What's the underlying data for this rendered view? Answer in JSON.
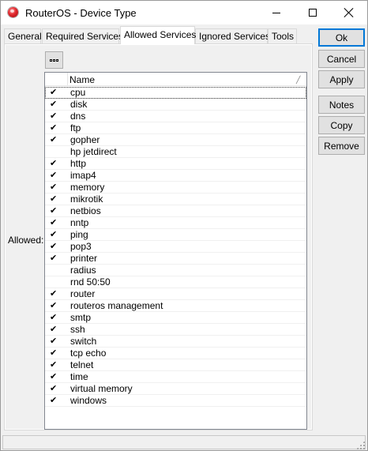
{
  "window": {
    "title": "RouterOS - Device Type"
  },
  "tabs": [
    {
      "label": "General"
    },
    {
      "label": "Required Services"
    },
    {
      "label": "Allowed Services",
      "active": true
    },
    {
      "label": "Ignored Services"
    },
    {
      "label": "Tools"
    }
  ],
  "form": {
    "allowed_label": "Allowed:",
    "column_name": "Name"
  },
  "services": [
    {
      "name": "cpu",
      "checked": true
    },
    {
      "name": "disk",
      "checked": true
    },
    {
      "name": "dns",
      "checked": true
    },
    {
      "name": "ftp",
      "checked": true
    },
    {
      "name": "gopher",
      "checked": true
    },
    {
      "name": "hp jetdirect",
      "checked": false
    },
    {
      "name": "http",
      "checked": true
    },
    {
      "name": "imap4",
      "checked": true
    },
    {
      "name": "memory",
      "checked": true
    },
    {
      "name": "mikrotik",
      "checked": true
    },
    {
      "name": "netbios",
      "checked": true
    },
    {
      "name": "nntp",
      "checked": true
    },
    {
      "name": "ping",
      "checked": true
    },
    {
      "name": "pop3",
      "checked": true
    },
    {
      "name": "printer",
      "checked": true
    },
    {
      "name": "radius",
      "checked": false
    },
    {
      "name": "rnd 50:50",
      "checked": false
    },
    {
      "name": "router",
      "checked": true
    },
    {
      "name": "routeros management",
      "checked": true
    },
    {
      "name": "smtp",
      "checked": true
    },
    {
      "name": "ssh",
      "checked": true
    },
    {
      "name": "switch",
      "checked": true
    },
    {
      "name": "tcp echo",
      "checked": true
    },
    {
      "name": "telnet",
      "checked": true
    },
    {
      "name": "time",
      "checked": true
    },
    {
      "name": "virtual memory",
      "checked": true
    },
    {
      "name": "windows",
      "checked": true
    }
  ],
  "buttons": {
    "ok": "Ok",
    "cancel": "Cancel",
    "apply": "Apply",
    "notes": "Notes",
    "copy": "Copy",
    "remove": "Remove"
  },
  "icons": {
    "app": "routeros-app-icon",
    "more": "ellipsis-icon",
    "check": "checkmark-icon",
    "sort": "sort-indicator-icon"
  },
  "colors": {
    "accent": "#0078d7",
    "window_bg": "#f0f0f0",
    "list_border": "#828790"
  }
}
